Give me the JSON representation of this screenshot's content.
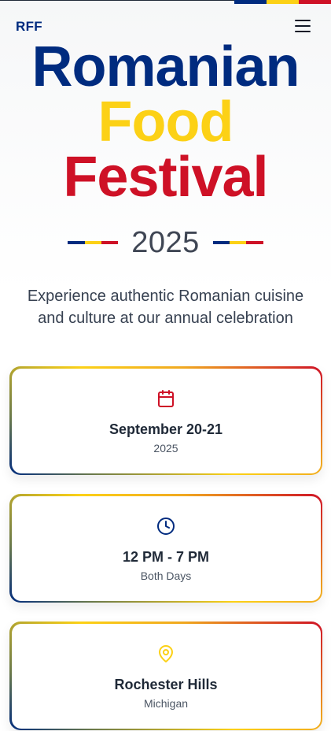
{
  "header": {
    "logo": "RFF",
    "menu_icon": "hamburger-menu-icon"
  },
  "hero": {
    "line1": "Romanian",
    "line2": "Food",
    "line3": "Festival",
    "year": "2025",
    "subtitle": "Experience authentic Romanian cuisine and culture at our annual celebration"
  },
  "cards": [
    {
      "icon": "calendar-icon",
      "title": "September 20-21",
      "subtitle": "2025"
    },
    {
      "icon": "clock-icon",
      "title": "12 PM - 7 PM",
      "subtitle": "Both Days"
    },
    {
      "icon": "map-pin-icon",
      "title": "Rochester Hills",
      "subtitle": "Michigan"
    }
  ],
  "colors": {
    "blue": "#002b7f",
    "yellow": "#fcd116",
    "red": "#ce1126",
    "text_dark": "#1f2937",
    "text_muted": "#4b5563"
  }
}
